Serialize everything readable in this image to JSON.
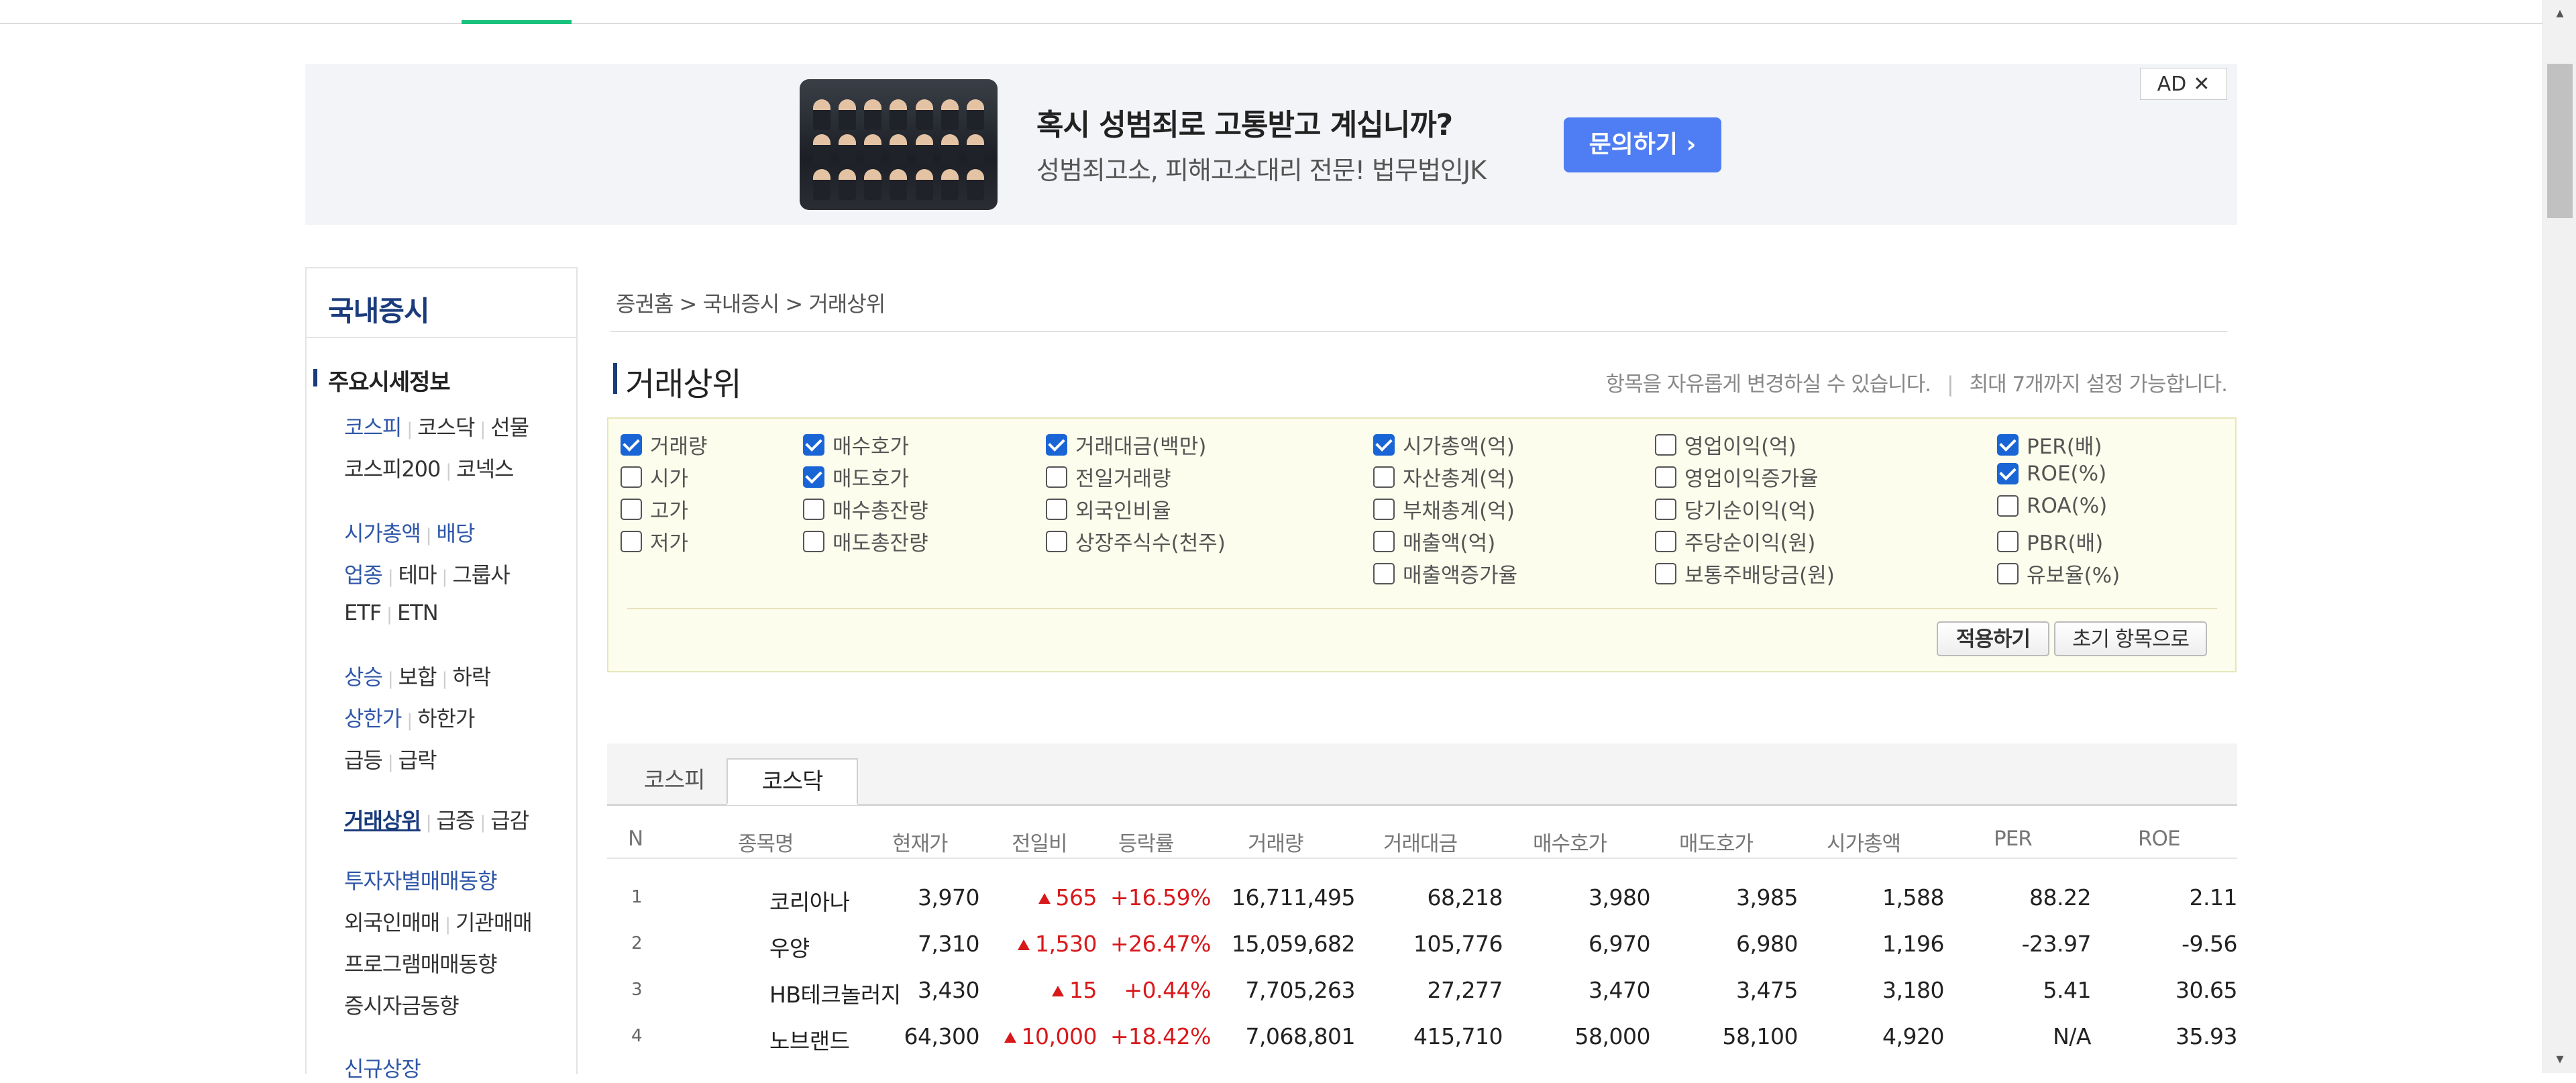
{
  "ad": {
    "title": "혹시 성범죄로 고통받고 계십니까?",
    "subtitle": "성범죄고소, 피해고소대리 전문! 법무법인JK",
    "button": "문의하기 ›",
    "mark": "AD",
    "close": "✕"
  },
  "lnb": {
    "title": "국내증시",
    "section": "주요시세정보",
    "rows": [
      [
        "코스피",
        "코스닥",
        "선물"
      ],
      [
        "코스피200",
        "코넥스"
      ],
      [
        "시가총액",
        "배당"
      ],
      [
        "업종",
        "테마",
        "그룹사"
      ],
      [
        "ETF",
        "ETN"
      ],
      [
        "상승",
        "보합",
        "하락"
      ],
      [
        "상한가",
        "하한가"
      ],
      [
        "급등",
        "급락"
      ],
      [
        "거래상위",
        "급증",
        "급감"
      ],
      [
        "투자자별매매동향"
      ],
      [
        "외국인매매",
        "기관매매"
      ],
      [
        "프로그램매매동향"
      ],
      [
        "증시자금동향"
      ],
      [
        "신규상장"
      ]
    ]
  },
  "breadcrumb": "증권홈 > 국내증시 > 거래상위",
  "page_title": "거래상위",
  "hint_left": "항목을 자유롭게 변경하실 수 있습니다.",
  "hint_sep": "|",
  "hint_right": "최대 7개까지 설정 가능합니다.",
  "options": [
    {
      "label": "거래량",
      "checked": true
    },
    {
      "label": "시가",
      "checked": false
    },
    {
      "label": "고가",
      "checked": false
    },
    {
      "label": "저가",
      "checked": false
    },
    {
      "label": "매수호가",
      "checked": true
    },
    {
      "label": "매도호가",
      "checked": true
    },
    {
      "label": "매수총잔량",
      "checked": false
    },
    {
      "label": "매도총잔량",
      "checked": false
    },
    {
      "label": "거래대금(백만)",
      "checked": true
    },
    {
      "label": "전일거래량",
      "checked": false
    },
    {
      "label": "외국인비율",
      "checked": false
    },
    {
      "label": "상장주식수(천주)",
      "checked": false
    },
    {
      "label": "시가총액(억)",
      "checked": true
    },
    {
      "label": "자산총계(억)",
      "checked": false
    },
    {
      "label": "부채총계(억)",
      "checked": false
    },
    {
      "label": "매출액(억)",
      "checked": false
    },
    {
      "label": "매출액증가율",
      "checked": false
    },
    {
      "label": "영업이익(억)",
      "checked": false
    },
    {
      "label": "영업이익증가율",
      "checked": false
    },
    {
      "label": "당기순이익(억)",
      "checked": false
    },
    {
      "label": "주당순이익(원)",
      "checked": false
    },
    {
      "label": "보통주배당금(원)",
      "checked": false
    },
    {
      "label": "PER(배)",
      "checked": true
    },
    {
      "label": "ROE(%)",
      "checked": true
    },
    {
      "label": "ROA(%)",
      "checked": false
    },
    {
      "label": "PBR(배)",
      "checked": false
    },
    {
      "label": "유보율(%)",
      "checked": false
    }
  ],
  "buttons": {
    "apply": "적용하기",
    "reset": "초기 항목으로"
  },
  "tabs": [
    {
      "label": "코스피",
      "active": false
    },
    {
      "label": "코스닥",
      "active": true
    }
  ],
  "table": {
    "columns": [
      "N",
      "종목명",
      "현재가",
      "전일비",
      "등락률",
      "거래량",
      "거래대금",
      "매수호가",
      "매도호가",
      "시가총액",
      "PER",
      "ROE"
    ],
    "rows": [
      [
        "1",
        "코리아나",
        "3,970",
        "565",
        "+16.59%",
        "16,711,495",
        "68,218",
        "3,980",
        "3,985",
        "1,588",
        "88.22",
        "2.11"
      ],
      [
        "2",
        "우양",
        "7,310",
        "1,530",
        "+26.47%",
        "15,059,682",
        "105,776",
        "6,970",
        "6,980",
        "1,196",
        "-23.97",
        "-9.56"
      ],
      [
        "3",
        "HB테크놀러지",
        "3,430",
        "15",
        "+0.44%",
        "7,705,263",
        "27,277",
        "3,470",
        "3,475",
        "3,180",
        "5.41",
        "30.65"
      ],
      [
        "4",
        "노브랜드",
        "64,300",
        "10,000",
        "+18.42%",
        "7,068,801",
        "415,710",
        "58,000",
        "58,100",
        "4,920",
        "N/A",
        "35.93"
      ]
    ]
  },
  "colors": {
    "accent": "#1a3b7c",
    "up": "#d8191c",
    "link": "#2f57a8",
    "checkbox": "#1a65d6",
    "ad_button": "#4f7df3"
  }
}
